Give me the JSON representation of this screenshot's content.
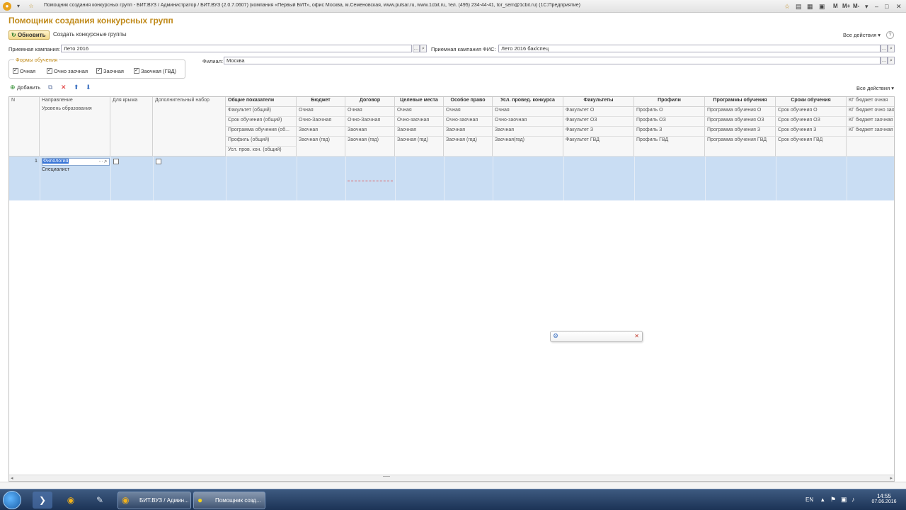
{
  "window": {
    "title": "Помощник создания конкурсных групп - БИТ.ВУЗ / Администратор / БИТ.ВУЗ (2.0.7.0607) (компания «Первый БИТ», офис Москва, м.Семеновская, www.pulsar.ru, www.1cbit.ru, тел. (495) 234-44-41, tor_sem@1cbit.ru) (1С:Предприятие)",
    "right_controls": [
      "M",
      "M+",
      "M-"
    ]
  },
  "form": {
    "heading": "Помощник создания конкурсных групп",
    "refresh_label": "Обновить",
    "create_groups_label": "Создать конкурсные группы",
    "all_actions_label": "Все действия",
    "help_label": "?"
  },
  "filters": {
    "campaign_label": "Приемная кампания:",
    "campaign_value": "Лето 2016",
    "fis_campaign_label": "Приемная кампания ФИС:",
    "fis_campaign_value": "Лето 2016 бак/спец",
    "branch_label": "Филиал:",
    "branch_value": "Москва",
    "study_forms_title": "Формы обучения",
    "study_forms": [
      {
        "label": "Очная",
        "checked": true
      },
      {
        "label": "Очно заочная",
        "checked": true
      },
      {
        "label": "Заочная",
        "checked": true
      },
      {
        "label": "Заочная (ГВД)",
        "checked": true
      }
    ]
  },
  "table_toolbar": {
    "add_label": "Добавить",
    "all_actions_label": "Все действия"
  },
  "grid": {
    "columns": {
      "n": "N",
      "direction": "Направление",
      "education_level": "Уровень образования",
      "for_crimea": "Для крыма",
      "additional_set": "Дополнительный набор",
      "common": "Общие показатели",
      "budget": "Бюджет",
      "contract": "Договор",
      "target": "Целевые места",
      "special": "Особое право",
      "conditions": "Усл. провед. конкурса",
      "faculties": "Факультеты",
      "profiles": "Профили",
      "programs": "Программы обучения",
      "terms": "Сроки обучения",
      "kg": "КГ бюджет очная"
    },
    "common_sub": [
      "Факультет (общий)",
      "Срок обучения (общий)",
      "Программа обучения (об...",
      "Профиль (общий)",
      "Усл. пров. кон. (общий)"
    ],
    "budget_sub": [
      "Очная",
      "Очно-Заочная",
      "Заочная",
      "Заочная (гвд)"
    ],
    "contract_sub": [
      "Очная",
      "Очно-Заочная",
      "Заочная",
      "Заочная (гвд)"
    ],
    "target_sub": [
      "Очная",
      "Очно-заочная",
      "Заочная",
      "Заочная (гвд)"
    ],
    "special_sub": [
      "Очная",
      "Очно-заочная",
      "Заочная",
      "Заочная (гвд)"
    ],
    "conditions_sub": [
      "Очная",
      "Очно-заочная",
      "Заочная",
      "Заочная(гвд)"
    ],
    "faculties_sub": [
      "Факультет О",
      "Факультет ОЗ",
      "Факультет З",
      "Факультет ГВД"
    ],
    "profiles_sub": [
      "Профиль О",
      "Профиль ОЗ",
      "Профиль З",
      "Профиль ГВД"
    ],
    "programs_sub": [
      "Программа обучения О",
      "Программа обучения ОЗ",
      "Программа обучения З",
      "Программа обучения ГВД"
    ],
    "terms_sub": [
      "Срок обучения О",
      "Срок обучения ОЗ",
      "Срок обучения З",
      "Срок обучения ГВД"
    ],
    "kg_sub": [
      "КГ бюджет очно зао",
      "КГ бюджет заочная",
      "КГ бюджет заочная"
    ],
    "row": {
      "n": "1",
      "direction": "Филология",
      "education_level": "Специалист"
    }
  },
  "taskbar": {
    "task1": "БИТ.ВУЗ / Админ...",
    "task2": "Помощник созд...",
    "lang": "EN",
    "time": "14:55",
    "date": "07.06.2016"
  }
}
